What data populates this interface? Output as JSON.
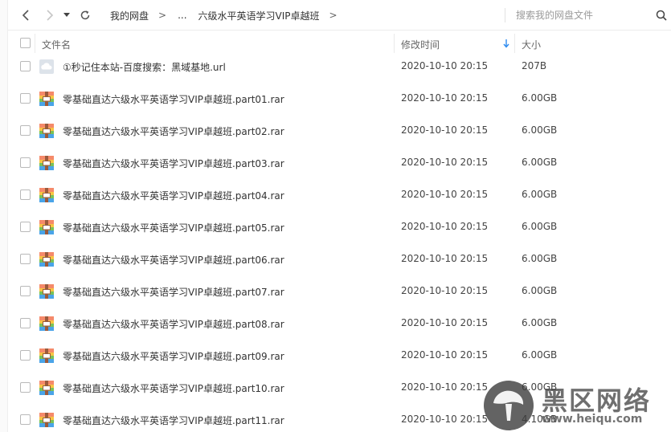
{
  "toolbar": {
    "breadcrumbs": [
      "我的网盘",
      "...",
      "六级水平英语学习VIP卓越班"
    ],
    "separator": ">",
    "search_placeholder": "搜索我的网盘文件"
  },
  "header": {
    "name": "文件名",
    "modified": "修改时间",
    "size": "大小"
  },
  "colors": {
    "sort_arrow": "#2e8bf0",
    "checkbox_border": "#b9b9b9",
    "watermark_text": "#464646"
  },
  "files": [
    {
      "icon": "url-file-icon",
      "name": "①秒记住本站-百度搜索：黑域基地.url",
      "modified": "2020-10-10 20:15",
      "size": "207B"
    },
    {
      "icon": "rar-archive-icon",
      "name": "零基础直达六级水平英语学习VIP卓越班.part01.rar",
      "modified": "2020-10-10 20:15",
      "size": "6.00GB"
    },
    {
      "icon": "rar-archive-icon",
      "name": "零基础直达六级水平英语学习VIP卓越班.part02.rar",
      "modified": "2020-10-10 20:15",
      "size": "6.00GB"
    },
    {
      "icon": "rar-archive-icon",
      "name": "零基础直达六级水平英语学习VIP卓越班.part03.rar",
      "modified": "2020-10-10 20:15",
      "size": "6.00GB"
    },
    {
      "icon": "rar-archive-icon",
      "name": "零基础直达六级水平英语学习VIP卓越班.part04.rar",
      "modified": "2020-10-10 20:15",
      "size": "6.00GB"
    },
    {
      "icon": "rar-archive-icon",
      "name": "零基础直达六级水平英语学习VIP卓越班.part05.rar",
      "modified": "2020-10-10 20:15",
      "size": "6.00GB"
    },
    {
      "icon": "rar-archive-icon",
      "name": "零基础直达六级水平英语学习VIP卓越班.part06.rar",
      "modified": "2020-10-10 20:15",
      "size": "6.00GB"
    },
    {
      "icon": "rar-archive-icon",
      "name": "零基础直达六级水平英语学习VIP卓越班.part07.rar",
      "modified": "2020-10-10 20:15",
      "size": "6.00GB"
    },
    {
      "icon": "rar-archive-icon",
      "name": "零基础直达六级水平英语学习VIP卓越班.part08.rar",
      "modified": "2020-10-10 20:15",
      "size": "6.00GB"
    },
    {
      "icon": "rar-archive-icon",
      "name": "零基础直达六级水平英语学习VIP卓越班.part09.rar",
      "modified": "2020-10-10 20:15",
      "size": "6.00GB"
    },
    {
      "icon": "rar-archive-icon",
      "name": "零基础直达六级水平英语学习VIP卓越班.part10.rar",
      "modified": "2020-10-10 20:15",
      "size": "6.00GB"
    },
    {
      "icon": "rar-archive-icon",
      "name": "零基础直达六级水平英语学习VIP卓越班.part11.rar",
      "modified": "2020-10-10 20:15",
      "size": "4.10GB"
    }
  ],
  "watermark": {
    "text": "黑区网络",
    "url": "www.heiqu.com"
  }
}
